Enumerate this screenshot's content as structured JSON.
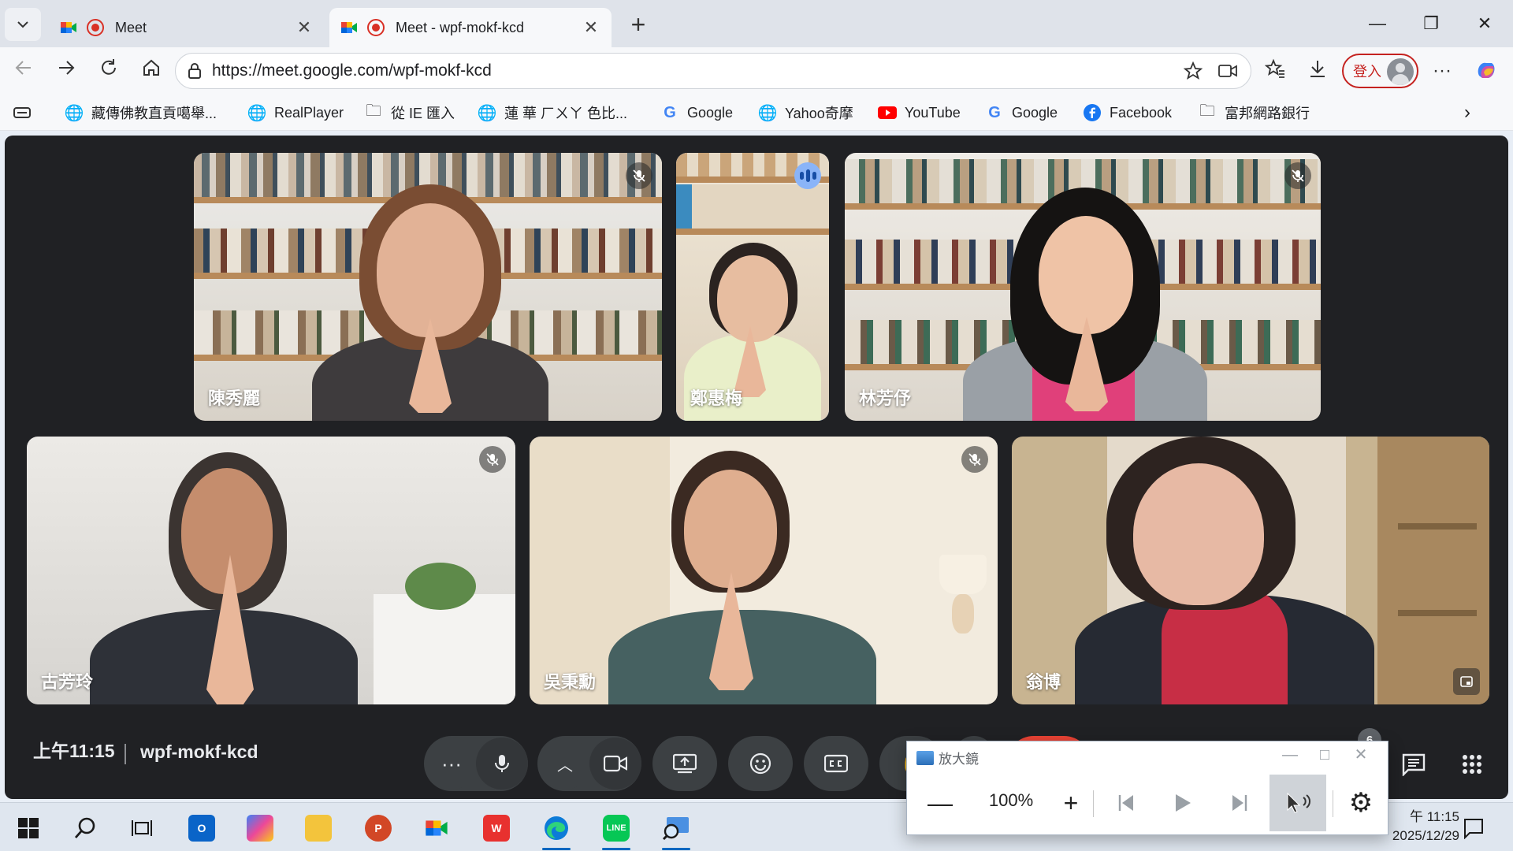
{
  "browser": {
    "tabs": [
      {
        "title": "Meet",
        "active": false
      },
      {
        "title": "Meet - wpf-mokf-kcd",
        "active": true
      }
    ],
    "url": "https://meet.google.com/wpf-mokf-kcd",
    "signin_label": "登入"
  },
  "bookmarks": [
    {
      "label": "藏傳佛教直貢噶舉...",
      "icon": "globe-icon"
    },
    {
      "label": "RealPlayer",
      "icon": "globe-icon"
    },
    {
      "label": "從 IE 匯入",
      "icon": "folder-icon"
    },
    {
      "label": "蓮 華 ㄏㄨㄚ 色比...",
      "icon": "globe-icon"
    },
    {
      "label": "Google",
      "icon": "google-icon"
    },
    {
      "label": "Yahoo奇摩",
      "icon": "globe-icon"
    },
    {
      "label": "YouTube",
      "icon": "youtube-icon"
    },
    {
      "label": "Google",
      "icon": "google-icon"
    },
    {
      "label": "Facebook",
      "icon": "facebook-icon"
    },
    {
      "label": "富邦網路銀行",
      "icon": "folder-icon"
    }
  ],
  "meet": {
    "participants": [
      {
        "name": "陳秀麗",
        "muted": true,
        "speaking": false
      },
      {
        "name": "鄭惠梅",
        "muted": false,
        "speaking": true
      },
      {
        "name": "林芳伃",
        "muted": true,
        "speaking": false
      },
      {
        "name": "古芳玲",
        "muted": true,
        "speaking": false
      },
      {
        "name": "吳秉勳",
        "muted": true,
        "speaking": false
      },
      {
        "name": "翁博",
        "muted": false,
        "speaking": false
      }
    ],
    "time": "上午11:15",
    "meeting_code": "wpf-mokf-kcd",
    "participant_count": "6"
  },
  "magnifier": {
    "title": "放大鏡",
    "zoom": "100%"
  },
  "taskbar": {
    "time": "午 11:15",
    "date": "2025/12/29"
  },
  "colors": {
    "meet_bg": "#202124",
    "control_bg": "#3c4043",
    "end_call": "#ea4335",
    "speaking_accent": "#8ab4f8",
    "signin_red": "#c5221f"
  }
}
